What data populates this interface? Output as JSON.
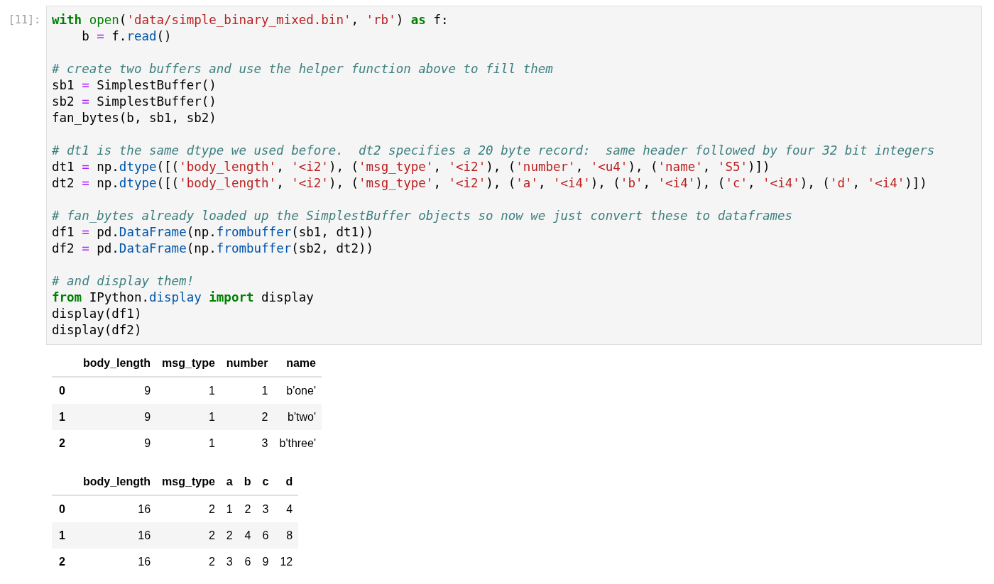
{
  "prompt": "[11]:",
  "code": {
    "blocks": [
      [
        [
          {
            "kind": "keyword",
            "text": "with"
          },
          {
            "kind": "builtin",
            "text": " open"
          },
          {
            "kind": "plain",
            "text": "("
          },
          {
            "kind": "string",
            "text": "'data/simple_binary_mixed.bin'"
          },
          {
            "kind": "plain",
            "text": ", "
          },
          {
            "kind": "string",
            "text": "'rb'"
          },
          {
            "kind": "plain",
            "text": ") "
          },
          {
            "kind": "keyword",
            "text": "as"
          },
          {
            "kind": "plain",
            "text": " f:"
          }
        ],
        [
          {
            "kind": "plain",
            "text": "    b "
          },
          {
            "kind": "operator",
            "text": "="
          },
          {
            "kind": "plain",
            "text": " f."
          },
          {
            "kind": "function",
            "text": "read"
          },
          {
            "kind": "plain",
            "text": "()"
          }
        ]
      ],
      [
        [
          {
            "kind": "comment",
            "text": "# create two buffers and use the helper function above to fill them"
          }
        ],
        [
          {
            "kind": "plain",
            "text": "sb1 "
          },
          {
            "kind": "operator",
            "text": "="
          },
          {
            "kind": "plain",
            "text": " SimplestBuffer()"
          }
        ],
        [
          {
            "kind": "plain",
            "text": "sb2 "
          },
          {
            "kind": "operator",
            "text": "="
          },
          {
            "kind": "plain",
            "text": " SimplestBuffer()"
          }
        ],
        [
          {
            "kind": "plain",
            "text": "fan_bytes(b, sb1, sb2)"
          }
        ]
      ],
      [
        [
          {
            "kind": "comment",
            "text": "# dt1 is the same dtype we used before.  dt2 specifies a 20 byte record:  same header followed by four 32 bit integers"
          }
        ],
        [
          {
            "kind": "plain",
            "text": "dt1 "
          },
          {
            "kind": "operator",
            "text": "="
          },
          {
            "kind": "plain",
            "text": " np."
          },
          {
            "kind": "function",
            "text": "dtype"
          },
          {
            "kind": "plain",
            "text": "([("
          },
          {
            "kind": "string",
            "text": "'body_length'"
          },
          {
            "kind": "plain",
            "text": ", "
          },
          {
            "kind": "string",
            "text": "'<i2'"
          },
          {
            "kind": "plain",
            "text": "), ("
          },
          {
            "kind": "string",
            "text": "'msg_type'"
          },
          {
            "kind": "plain",
            "text": ", "
          },
          {
            "kind": "string",
            "text": "'<i2'"
          },
          {
            "kind": "plain",
            "text": "), ("
          },
          {
            "kind": "string",
            "text": "'number'"
          },
          {
            "kind": "plain",
            "text": ", "
          },
          {
            "kind": "string",
            "text": "'<u4'"
          },
          {
            "kind": "plain",
            "text": "), ("
          },
          {
            "kind": "string",
            "text": "'name'"
          },
          {
            "kind": "plain",
            "text": ", "
          },
          {
            "kind": "string",
            "text": "'S5'"
          },
          {
            "kind": "plain",
            "text": ")])"
          }
        ],
        [
          {
            "kind": "plain",
            "text": "dt2 "
          },
          {
            "kind": "operator",
            "text": "="
          },
          {
            "kind": "plain",
            "text": " np."
          },
          {
            "kind": "function",
            "text": "dtype"
          },
          {
            "kind": "plain",
            "text": "([("
          },
          {
            "kind": "string",
            "text": "'body_length'"
          },
          {
            "kind": "plain",
            "text": ", "
          },
          {
            "kind": "string",
            "text": "'<i2'"
          },
          {
            "kind": "plain",
            "text": "), ("
          },
          {
            "kind": "string",
            "text": "'msg_type'"
          },
          {
            "kind": "plain",
            "text": ", "
          },
          {
            "kind": "string",
            "text": "'<i2'"
          },
          {
            "kind": "plain",
            "text": "), ("
          },
          {
            "kind": "string",
            "text": "'a'"
          },
          {
            "kind": "plain",
            "text": ", "
          },
          {
            "kind": "string",
            "text": "'<i4'"
          },
          {
            "kind": "plain",
            "text": "), ("
          },
          {
            "kind": "string",
            "text": "'b'"
          },
          {
            "kind": "plain",
            "text": ", "
          },
          {
            "kind": "string",
            "text": "'<i4'"
          },
          {
            "kind": "plain",
            "text": "), ("
          },
          {
            "kind": "string",
            "text": "'c'"
          },
          {
            "kind": "plain",
            "text": ", "
          },
          {
            "kind": "string",
            "text": "'<i4'"
          },
          {
            "kind": "plain",
            "text": "), ("
          },
          {
            "kind": "string",
            "text": "'d'"
          },
          {
            "kind": "plain",
            "text": ", "
          },
          {
            "kind": "string",
            "text": "'<i4'"
          },
          {
            "kind": "plain",
            "text": ")])"
          }
        ]
      ],
      [
        [
          {
            "kind": "comment",
            "text": "# fan_bytes already loaded up the SimplestBuffer objects so now we just convert these to dataframes"
          }
        ],
        [
          {
            "kind": "plain",
            "text": "df1 "
          },
          {
            "kind": "operator",
            "text": "="
          },
          {
            "kind": "plain",
            "text": " pd."
          },
          {
            "kind": "function",
            "text": "DataFrame"
          },
          {
            "kind": "plain",
            "text": "(np."
          },
          {
            "kind": "function",
            "text": "frombuffer"
          },
          {
            "kind": "plain",
            "text": "(sb1, dt1))"
          }
        ],
        [
          {
            "kind": "plain",
            "text": "df2 "
          },
          {
            "kind": "operator",
            "text": "="
          },
          {
            "kind": "plain",
            "text": " pd."
          },
          {
            "kind": "function",
            "text": "DataFrame"
          },
          {
            "kind": "plain",
            "text": "(np."
          },
          {
            "kind": "function",
            "text": "frombuffer"
          },
          {
            "kind": "plain",
            "text": "(sb2, dt2))"
          }
        ]
      ],
      [
        [
          {
            "kind": "comment",
            "text": "# and display them!"
          }
        ],
        [
          {
            "kind": "keyword",
            "text": "from"
          },
          {
            "kind": "plain",
            "text": " IPython."
          },
          {
            "kind": "function",
            "text": "display"
          },
          {
            "kind": "keyword",
            "text": " import"
          },
          {
            "kind": "plain",
            "text": " display"
          }
        ],
        [
          {
            "kind": "plain",
            "text": "display(df1)"
          }
        ],
        [
          {
            "kind": "plain",
            "text": "display(df2)"
          }
        ]
      ]
    ]
  },
  "tables": [
    {
      "columns": [
        "body_length",
        "msg_type",
        "number",
        "name"
      ],
      "rows": [
        {
          "index": "0",
          "cells": [
            "9",
            "1",
            "1",
            "b'one'"
          ]
        },
        {
          "index": "1",
          "cells": [
            "9",
            "1",
            "2",
            "b'two'"
          ]
        },
        {
          "index": "2",
          "cells": [
            "9",
            "1",
            "3",
            "b'three'"
          ]
        }
      ]
    },
    {
      "columns": [
        "body_length",
        "msg_type",
        "a",
        "b",
        "c",
        "d"
      ],
      "rows": [
        {
          "index": "0",
          "cells": [
            "16",
            "2",
            "1",
            "2",
            "3",
            "4"
          ]
        },
        {
          "index": "1",
          "cells": [
            "16",
            "2",
            "2",
            "4",
            "6",
            "8"
          ]
        },
        {
          "index": "2",
          "cells": [
            "16",
            "2",
            "3",
            "6",
            "9",
            "12"
          ]
        }
      ]
    }
  ]
}
